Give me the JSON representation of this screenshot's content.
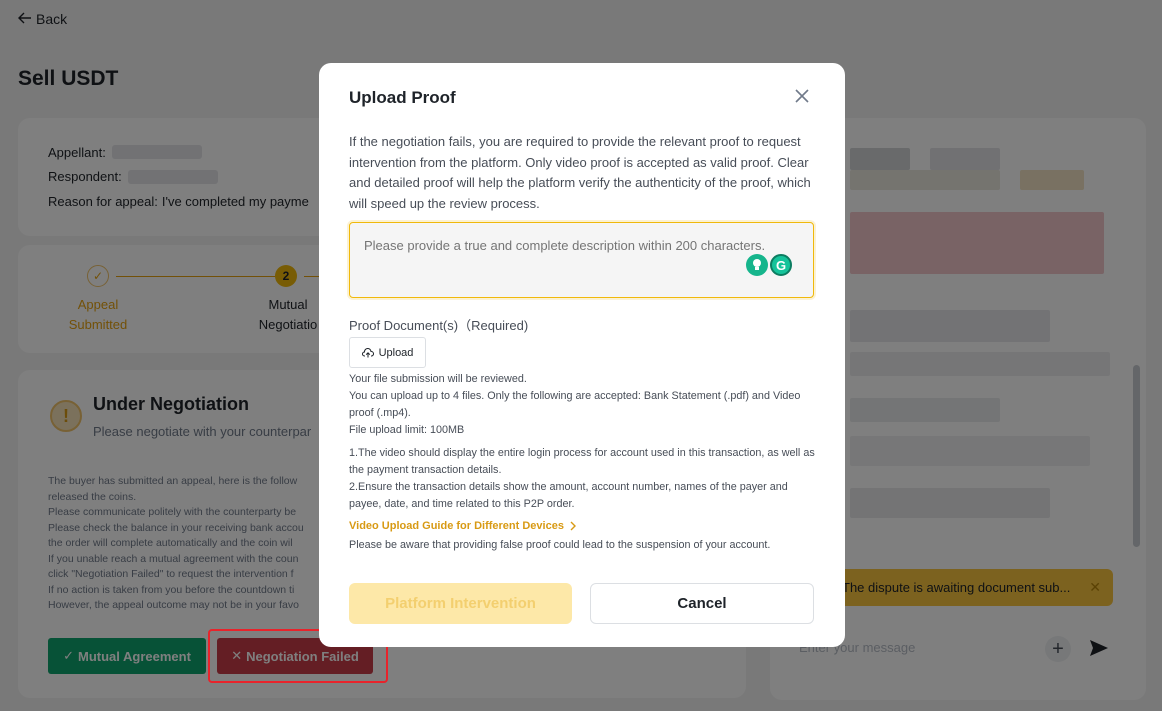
{
  "nav": {
    "back_label": "Back"
  },
  "page": {
    "title": "Sell USDT"
  },
  "appeal_info": {
    "appellant_label": "Appellant:",
    "respondent_label": "Respondent:",
    "reason_label": "Reason for appeal:",
    "reason_value": "I've completed my payme"
  },
  "steps": [
    {
      "label_line1": "Appeal",
      "label_line2": "Submitted",
      "state": "done"
    },
    {
      "number": "2",
      "label_line1": "Mutual",
      "label_line2": "Negotiatio",
      "state": "current"
    }
  ],
  "negotiation": {
    "title": "Under Negotiation",
    "subtitle": "Please negotiate with your counterpar",
    "lines": [
      "The buyer has submitted an appeal, here is the follow",
      "released the coins.",
      "Please communicate politely with the counterparty be",
      "Please check the balance in your receiving bank accou",
      "the order will complete automatically and the coin wil",
      "If you unable reach a mutual agreement with the coun",
      "click \"Negotiation Failed\" to request the intervention f",
      "If no action is taken from you before the countdown ti",
      "However, the appeal outcome may not be in your favo"
    ],
    "agree_label": "Mutual Agreement",
    "failed_label": "Negotiation Failed"
  },
  "chat": {
    "banner_text": "The dispute is awaiting document sub...",
    "input_placeholder": "Enter your message"
  },
  "modal": {
    "title": "Upload Proof",
    "description": "If the negotiation fails, you are required to provide the relevant proof to request intervention from the platform. Only video proof is accepted as valid proof. Clear and detailed proof will help the platform verify the authenticity of the proof, which will speed up the review process.",
    "textarea_placeholder": "Please provide a true and complete description within 200 characters.",
    "proof_label": "Proof Document(s)（Required)",
    "upload_label": "Upload",
    "file_info": [
      "Your file submission will be reviewed.",
      "You can upload up to 4 files. Only the following are accepted: Bank Statement (.pdf) and Video proof (.mp4).",
      "File upload limit: 100MB"
    ],
    "requirements": [
      "1.The video should display the entire login process for account used in this transaction, as well as the payment transaction details.",
      "2.Ensure the transaction details show the amount, account number, names of the payer and payee, date, and time related to this P2P order."
    ],
    "guide_link": "Video Upload Guide for Different Devices",
    "warning": "Please be aware that providing false proof could lead to the suspension of your account.",
    "platform_button": "Platform Intervention",
    "cancel_button": "Cancel"
  },
  "colors": {
    "accent": "#F0B90B",
    "success": "#0EA46E",
    "danger": "#C93D48",
    "highlight_border": "#E8232B"
  }
}
